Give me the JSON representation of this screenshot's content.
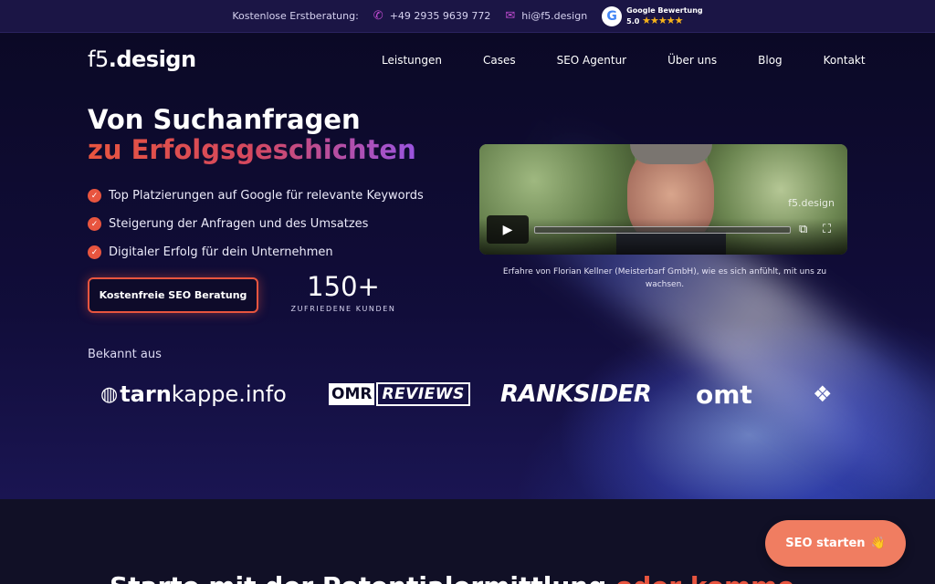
{
  "topbar": {
    "consult_label": "Kostenlose Erstberatung:",
    "phone": "+49 2935 9639 772",
    "email": "hi@f5.design",
    "google_label": "Google Bewertung",
    "rating": "5.0",
    "stars": "★★★★★"
  },
  "logo": {
    "part1": "f5",
    "part2": ".design"
  },
  "nav": [
    "Leistungen",
    "Cases",
    "SEO Agentur",
    "Über uns",
    "Blog",
    "Kontakt"
  ],
  "hero": {
    "title_line1": "Von Suchanfragen",
    "title_line2": "zu Erfolgsgeschichten",
    "bullets": [
      "Top Platzierungen auf Google für relevante Keywords",
      "Steigerung der Anfragen und des Umsatzes",
      "Digitaler Erfolg für dein Unternehmen"
    ],
    "cta_label": "Kostenfreie SEO Beratung",
    "stat_number": "150+",
    "stat_label": "ZUFRIEDENE KUNDEN"
  },
  "video": {
    "watermark": "f5.design",
    "caption": "Erfahre von Florian Kellner (Meisterbarf GmbH), wie es sich anfühlt, mit uns zu wachsen."
  },
  "known": {
    "label": "Bekannt aus",
    "logos": {
      "tarn1": "tarn",
      "tarn2": "kappe.info",
      "omr_tag": "OMR",
      "omr_text": "REVIEWS",
      "ranksider": "RANKSIDER",
      "omt": "omt"
    }
  },
  "bottom": {
    "heading": "Starte mit der Potentialermittlung ",
    "heading_accent": "oder komme",
    "seo_button": "SEO starten",
    "seo_emoji": "👋"
  },
  "colors": {
    "accent": "#e8553f",
    "purple": "#9a54e0",
    "button": "#f07d61",
    "bg": "#0c0a26"
  }
}
